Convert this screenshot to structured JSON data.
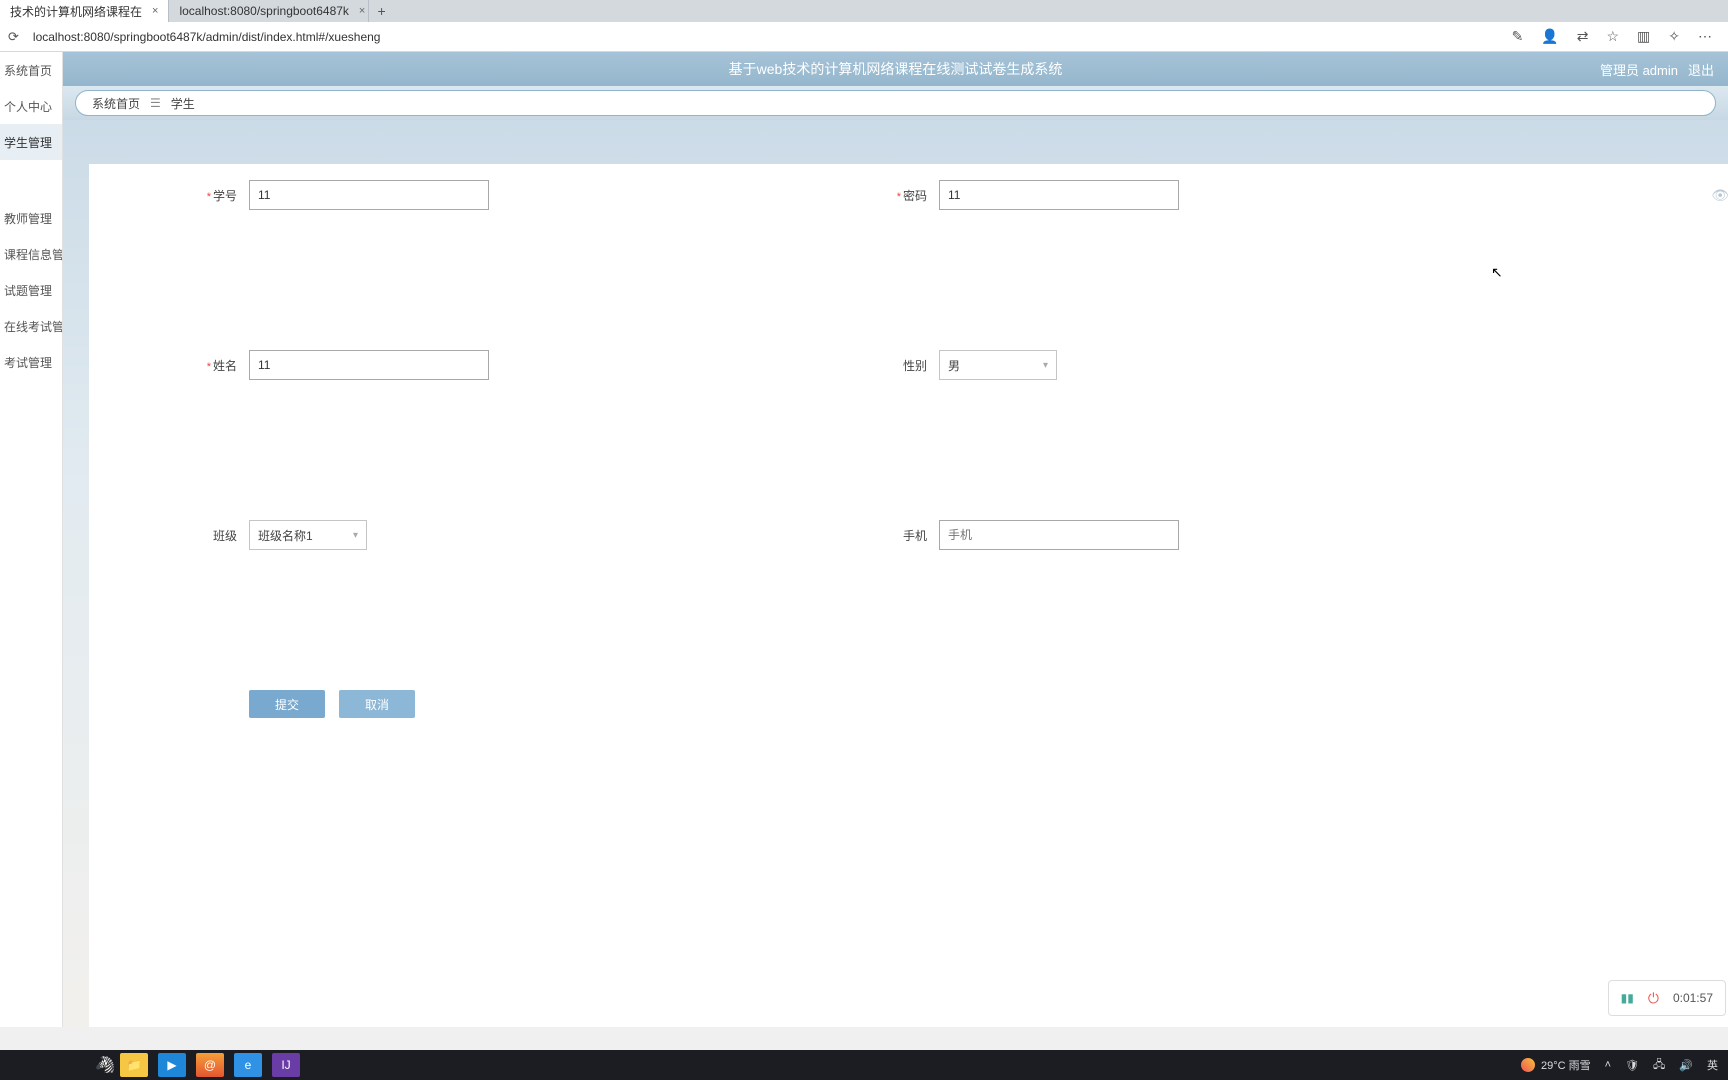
{
  "browser": {
    "tabs": [
      {
        "title": "技术的计算机网络课程在"
      },
      {
        "title": "localhost:8080/springboot6487k"
      }
    ],
    "url": "localhost:8080/springboot6487k/admin/dist/index.html#/xuesheng"
  },
  "header": {
    "title": "基于web技术的计算机网络课程在线测试试卷生成系统",
    "user_label": "管理员 admin",
    "logout": "退出"
  },
  "breadcrumb": {
    "home": "系统首页",
    "current": "学生"
  },
  "sidebar": {
    "items": [
      {
        "label": "系统首页"
      },
      {
        "label": "个人中心"
      },
      {
        "label": "学生管理"
      },
      {
        "label": "教师管理"
      },
      {
        "label": "课程信息管理"
      },
      {
        "label": "试题管理"
      },
      {
        "label": "在线考试管理"
      },
      {
        "label": "考试管理"
      }
    ]
  },
  "form": {
    "xuehao": {
      "label": "学号",
      "value": "11"
    },
    "mima": {
      "label": "密码",
      "value": "11"
    },
    "xingming": {
      "label": "姓名",
      "value": "11"
    },
    "xingbie": {
      "label": "性别",
      "value": "男"
    },
    "banji": {
      "label": "班级",
      "value": "班级名称1"
    },
    "shouji": {
      "label": "手机",
      "value": "",
      "placeholder": "手机"
    },
    "submit": "提交",
    "cancel": "取消"
  },
  "widget": {
    "time": "0:01:57"
  },
  "tray": {
    "weather": "29°C 雨雪",
    "ime": "英"
  }
}
